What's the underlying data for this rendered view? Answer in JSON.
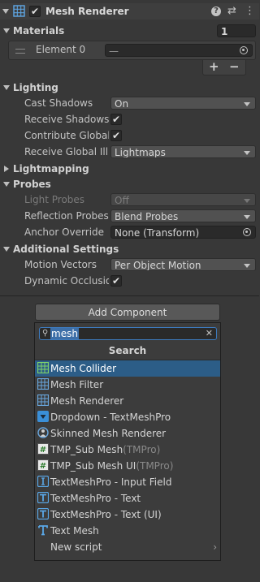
{
  "component": {
    "title": "Mesh Renderer",
    "enabled": true,
    "help_icon": "help-icon",
    "preset_icon": "preset-icon",
    "menu_icon": "kebab-menu-icon"
  },
  "materials": {
    "label": "Materials",
    "count": "1",
    "element_label": "Element 0",
    "element_value": "—",
    "add_button": "+",
    "remove_button": "−"
  },
  "lighting": {
    "label": "Lighting",
    "cast_shadows_label": "Cast Shadows",
    "cast_shadows_value": "On",
    "receive_shadows_label": "Receive Shadows",
    "receive_shadows_checked": true,
    "contribute_gi_label": "Contribute Global Illumination",
    "contribute_gi_checked": true,
    "receive_gi_label": "Receive Global Illumination",
    "receive_gi_value": "Lightmaps"
  },
  "lightmapping": {
    "label": "Lightmapping"
  },
  "probes": {
    "label": "Probes",
    "light_probes_label": "Light Probes",
    "light_probes_value": "Off",
    "reflection_probes_label": "Reflection Probes",
    "reflection_probes_value": "Blend Probes",
    "anchor_override_label": "Anchor Override",
    "anchor_override_value": "None (Transform)"
  },
  "additional": {
    "label": "Additional Settings",
    "motion_vectors_label": "Motion Vectors",
    "motion_vectors_value": "Per Object Motion",
    "dynamic_occlusion_label": "Dynamic Occlusion",
    "dynamic_occlusion_checked": true
  },
  "add_component": {
    "button_label": "Add Component",
    "search_value": "mesh",
    "search_header": "Search",
    "items": [
      {
        "name": "Mesh Collider",
        "tag": "",
        "icon": "mesh-collider-icon",
        "selected": true
      },
      {
        "name": "Mesh Filter",
        "tag": "",
        "icon": "mesh-filter-icon",
        "selected": false
      },
      {
        "name": "Mesh Renderer",
        "tag": "",
        "icon": "mesh-renderer-icon",
        "selected": false
      },
      {
        "name": "Dropdown - TextMeshPro",
        "tag": "",
        "icon": "dropdown-icon",
        "selected": false
      },
      {
        "name": "Skinned Mesh Renderer",
        "tag": "",
        "icon": "skinned-mesh-renderer-icon",
        "selected": false
      },
      {
        "name": "TMP_Sub Mesh",
        "tag": "(TMPro)",
        "icon": "script-icon",
        "selected": false
      },
      {
        "name": "TMP_Sub Mesh UI",
        "tag": "(TMPro)",
        "icon": "script-icon",
        "selected": false
      },
      {
        "name": "TextMeshPro - Input Field",
        "tag": "",
        "icon": "input-field-icon",
        "selected": false
      },
      {
        "name": "TextMeshPro - Text",
        "tag": "",
        "icon": "textmeshpro-icon",
        "selected": false
      },
      {
        "name": "TextMeshPro - Text (UI)",
        "tag": "",
        "icon": "textmeshpro-icon",
        "selected": false
      },
      {
        "name": "Text Mesh",
        "tag": "",
        "icon": "text-mesh-icon",
        "selected": false
      }
    ],
    "new_script_label": "New script"
  }
}
